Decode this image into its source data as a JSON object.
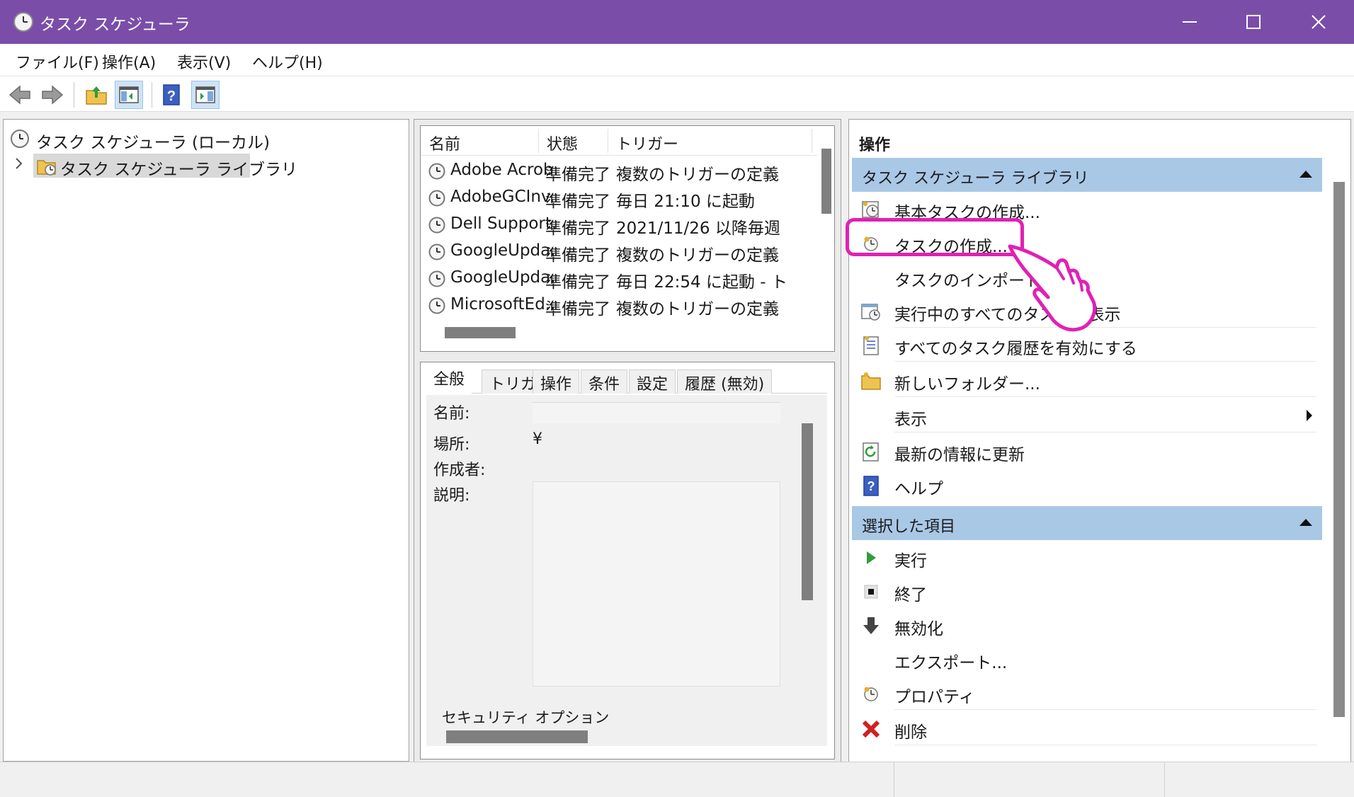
{
  "window": {
    "title": "タスク スケジューラ",
    "controls": [
      "minimize",
      "maximize",
      "close"
    ],
    "titlebar_color": "#7a4ea8"
  },
  "menu": [
    "ファイル(F)",
    "操作(A)",
    "表示(V)",
    "ヘルプ(H)"
  ],
  "toolbar": {
    "buttons": [
      "back-arrow-icon",
      "forward-arrow-icon",
      "up-folder-icon",
      "show-hide-console-tree-icon",
      "help-icon",
      "show-hide-action-pane-icon"
    ]
  },
  "tree": {
    "root": "タスク スケジューラ (ローカル)",
    "library": "タスク スケジューラ ライブラリ"
  },
  "task_list": {
    "columns": [
      "名前",
      "状態",
      "トリガー"
    ],
    "rows": [
      {
        "name": "Adobe Acrob...",
        "status": "準備完了",
        "trigger": "複数のトリガーの定義"
      },
      {
        "name": "AdobeGCInv...",
        "status": "準備完了",
        "trigger": "毎日 21:10 に起動"
      },
      {
        "name": "Dell Support...",
        "status": "準備完了",
        "trigger": "2021/11/26 以降毎週"
      },
      {
        "name": "GoogleUpda...",
        "status": "準備完了",
        "trigger": "複数のトリガーの定義"
      },
      {
        "name": "GoogleUpda...",
        "status": "準備完了",
        "trigger": "毎日 22:54 に起動 - ト"
      },
      {
        "name": "MicrosoftEd...",
        "status": "準備完了",
        "trigger": "複数のトリガーの定義"
      }
    ]
  },
  "detail": {
    "tabs": [
      "全般",
      "トリガー",
      "操作",
      "条件",
      "設定",
      "履歴 (無効)"
    ],
    "active_tab": "全般",
    "labels": {
      "name": "名前:",
      "location": "場所:",
      "author": "作成者:",
      "description": "説明:"
    },
    "location_value": "¥",
    "security_options": "セキュリティ オプション"
  },
  "actions": {
    "title": "操作",
    "library_section": {
      "header": "タスク スケジューラ ライブラリ",
      "items": [
        {
          "label": "基本タスクの作成...",
          "icon": "basic-task-icon"
        },
        {
          "label": "タスクの作成...",
          "icon": "create-task-icon"
        },
        {
          "label": "タスクのインポート...",
          "icon": ""
        },
        {
          "label": "実行中のすべてのタスクを表示",
          "icon": "running-tasks-icon"
        },
        {
          "label": "すべてのタスク履歴を有効にする",
          "icon": "task-history-icon"
        },
        {
          "label": "新しいフォルダー...",
          "icon": "new-folder-icon"
        },
        {
          "label": "表示",
          "icon": ""
        },
        {
          "label": "最新の情報に更新",
          "icon": "refresh-icon"
        },
        {
          "label": "ヘルプ",
          "icon": "help-icon"
        }
      ]
    },
    "selected_section": {
      "header": "選択した項目",
      "items": [
        {
          "label": "実行",
          "icon": "run-icon"
        },
        {
          "label": "終了",
          "icon": "stop-icon"
        },
        {
          "label": "無効化",
          "icon": "disable-icon"
        },
        {
          "label": "エクスポート...",
          "icon": ""
        },
        {
          "label": "プロパティ",
          "icon": "properties-icon"
        },
        {
          "label": "削除",
          "icon": "delete-icon"
        }
      ]
    }
  },
  "annotation": {
    "highlight_color": "#e021b4",
    "highlight_target": "タスクの作成..."
  }
}
